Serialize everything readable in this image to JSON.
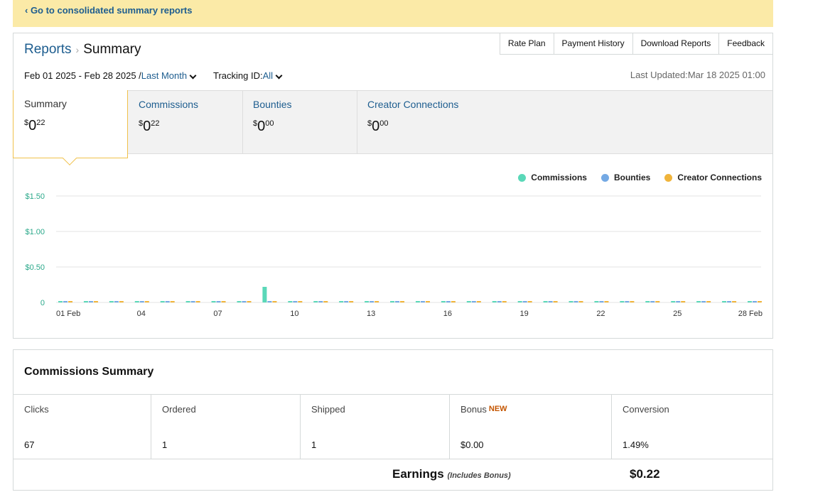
{
  "banner": {
    "link": "‹ Go to consolidated summary reports"
  },
  "breadcrumb": {
    "parent": "Reports",
    "current": "Summary"
  },
  "top_buttons": [
    "Rate Plan",
    "Payment History",
    "Download Reports",
    "Feedback"
  ],
  "date_range": {
    "text": "Feb 01 2025 - Feb 28 2025 /",
    "period": "Last Month"
  },
  "tracking": {
    "label": "Tracking ID:",
    "value": "All"
  },
  "last_updated": "Last Updated:Mar 18 2025 01:00",
  "tabs": [
    {
      "label": "Summary",
      "dollar": "$",
      "whole": "0",
      "cents": "22"
    },
    {
      "label": "Commissions",
      "dollar": "$",
      "whole": "0",
      "cents": "22"
    },
    {
      "label": "Bounties",
      "dollar": "$",
      "whole": "0",
      "cents": "00"
    },
    {
      "label": "Creator Connections",
      "dollar": "$",
      "whole": "0",
      "cents": "00"
    }
  ],
  "legend": [
    {
      "name": "Commissions",
      "color": "#5ad8b8"
    },
    {
      "name": "Bounties",
      "color": "#74a9e4"
    },
    {
      "name": "Creator Connections",
      "color": "#f0b43b"
    }
  ],
  "chart_data": {
    "type": "bar",
    "categories": [
      "01 Feb",
      "02",
      "03",
      "04",
      "05",
      "06",
      "07",
      "08",
      "09",
      "10",
      "11",
      "12",
      "13",
      "14",
      "15",
      "16",
      "17",
      "18",
      "19",
      "20",
      "21",
      "22",
      "23",
      "24",
      "25",
      "26",
      "27",
      "28 Feb"
    ],
    "x_tick_labels": [
      "01 Feb",
      "04",
      "07",
      "10",
      "13",
      "16",
      "19",
      "22",
      "25",
      "28 Feb"
    ],
    "y_tick_labels": [
      "0",
      "$0.50",
      "$1.00",
      "$1.50"
    ],
    "ylim": [
      0,
      1.5
    ],
    "series": [
      {
        "name": "Commissions",
        "values": [
          0,
          0,
          0,
          0,
          0,
          0,
          0,
          0,
          0.22,
          0,
          0,
          0,
          0,
          0,
          0,
          0,
          0,
          0,
          0,
          0,
          0,
          0,
          0,
          0,
          0,
          0,
          0,
          0
        ]
      },
      {
        "name": "Bounties",
        "values": [
          0,
          0,
          0,
          0,
          0,
          0,
          0,
          0,
          0,
          0,
          0,
          0,
          0,
          0,
          0,
          0,
          0,
          0,
          0,
          0,
          0,
          0,
          0,
          0,
          0,
          0,
          0,
          0
        ]
      },
      {
        "name": "Creator Connections",
        "values": [
          0,
          0,
          0,
          0,
          0,
          0,
          0,
          0,
          0,
          0,
          0,
          0,
          0,
          0,
          0,
          0,
          0,
          0,
          0,
          0,
          0,
          0,
          0,
          0,
          0,
          0,
          0,
          0
        ]
      }
    ],
    "grid": true,
    "legend_position": "top-right"
  },
  "commissions_summary": {
    "title": "Commissions Summary",
    "columns": [
      {
        "label": "Clicks",
        "value": "67"
      },
      {
        "label": "Ordered",
        "value": "1"
      },
      {
        "label": "Shipped",
        "value": "1"
      },
      {
        "label": "Bonus",
        "badge": "NEW",
        "value": "$0.00"
      },
      {
        "label": "Conversion",
        "value": "1.49%"
      }
    ],
    "earnings_label": "Earnings",
    "earnings_note": "(Includes Bonus)",
    "earnings_value": "$0.22"
  }
}
